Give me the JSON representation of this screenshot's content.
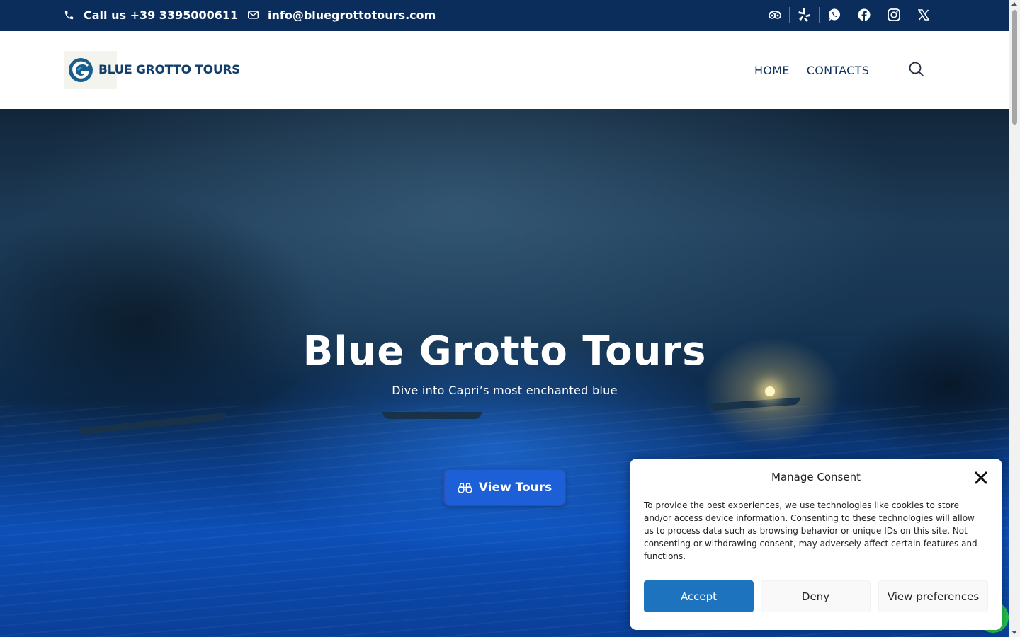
{
  "topbar": {
    "phone": "Call us +39 3395000611",
    "email": "info@bluegrottotours.com",
    "socials": [
      "tripadvisor-icon",
      "yelp-icon",
      "whatsapp-icon",
      "facebook-icon",
      "instagram-icon",
      "x-icon"
    ]
  },
  "header": {
    "logo_text": "BLUE GROTTO TOURS",
    "nav": [
      "HOME",
      "CONTACTS"
    ]
  },
  "hero": {
    "title": "Blue Grotto Tours",
    "subtitle": "Dive into Capri’s most enchanted blue",
    "cta": "View Tours"
  },
  "consent": {
    "title": "Manage Consent",
    "text": "To provide the best experiences, we use technologies like cookies to store and/or access device information. Consenting to these technologies will allow us to process data such as browsing behavior or unique IDs on this site. Not consenting or withdrawing consent, may adversely affect certain features and functions.",
    "accept": "Accept",
    "deny": "Deny",
    "preferences": "View preferences"
  },
  "colors": {
    "topbar": "#0b2d5c",
    "accent": "#1d5fd6",
    "accept": "#1e73be"
  }
}
